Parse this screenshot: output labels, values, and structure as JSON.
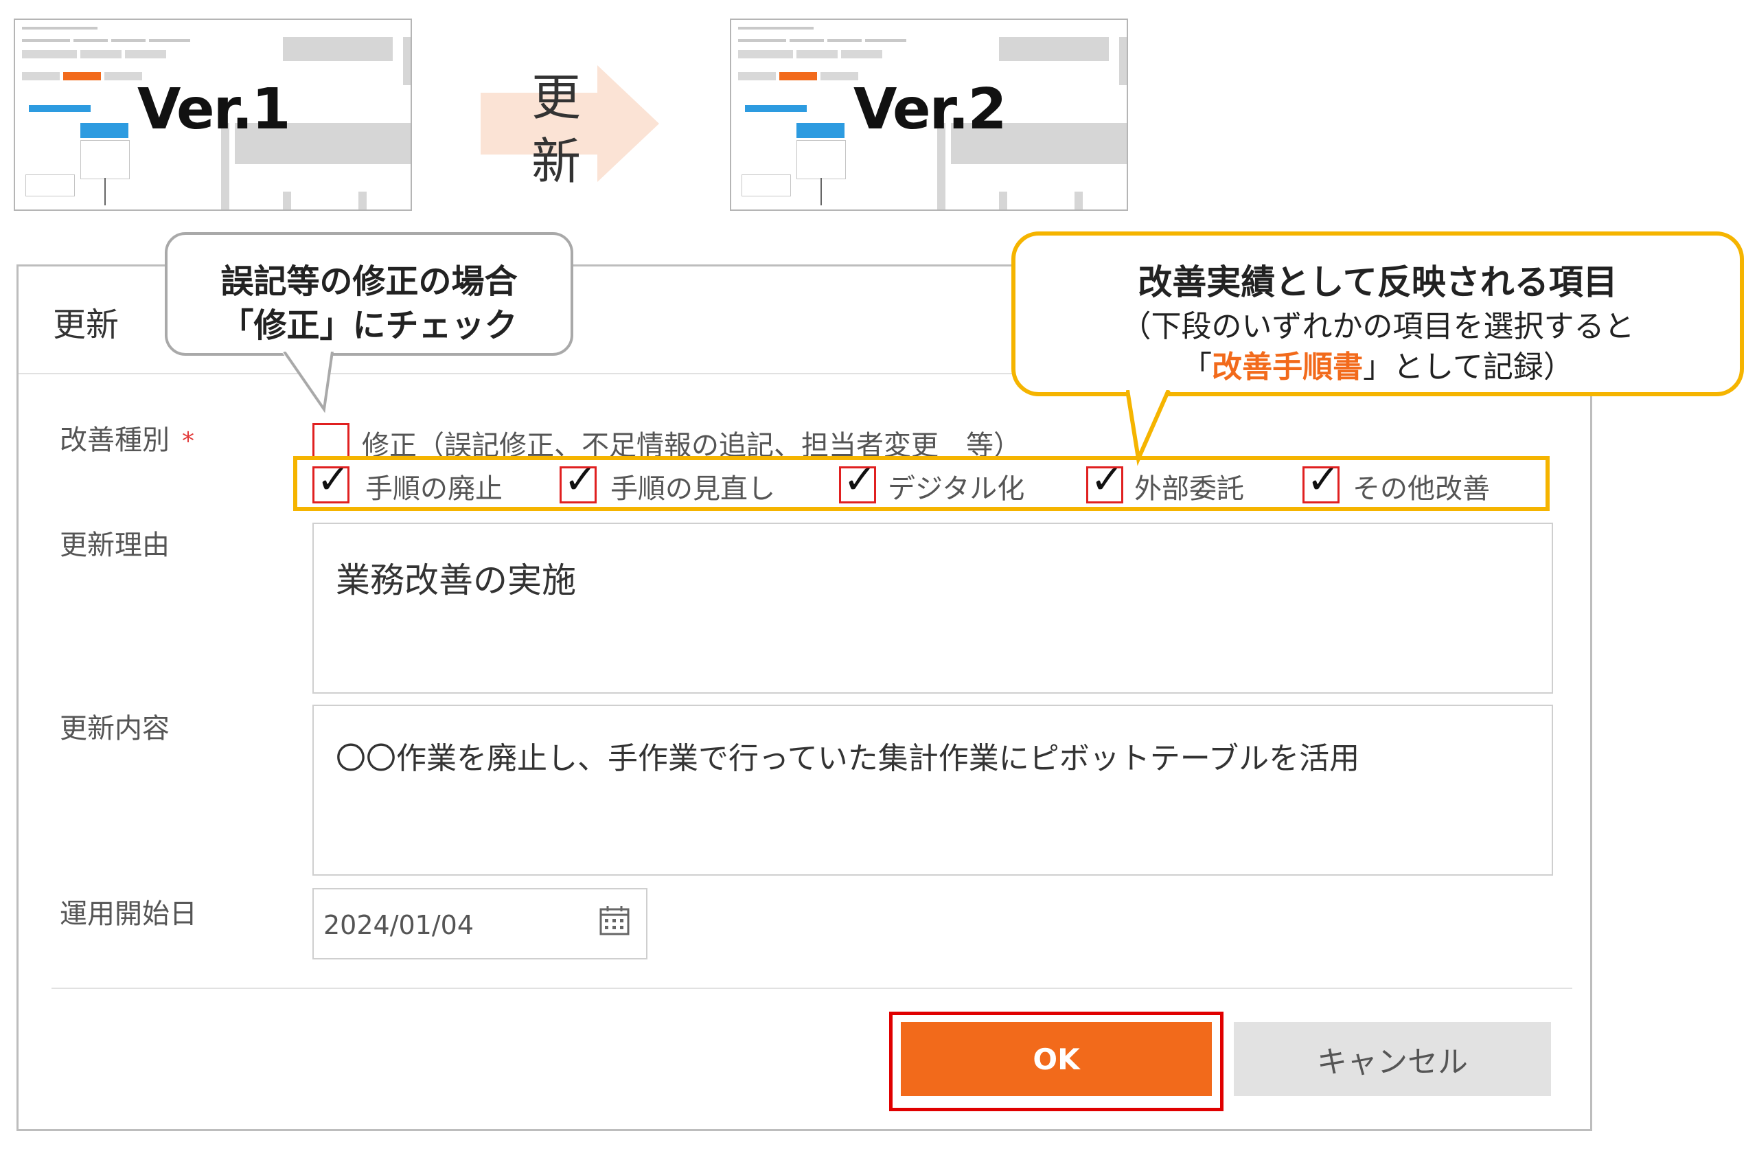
{
  "thumbnails": [
    {
      "version_label": "Ver.1"
    },
    {
      "version_label": "Ver.2"
    }
  ],
  "arrow": {
    "line1": "更",
    "line2": "新"
  },
  "dialog": {
    "title": "更新",
    "improvement_type": {
      "label": "改善種別",
      "required_mark": "*",
      "correction": {
        "label": "修正（誤記修正、不足情報の追記、担当者変更　等）",
        "checked": false
      },
      "options": [
        {
          "label": "手順の廃止",
          "checked": true
        },
        {
          "label": "手順の見直し",
          "checked": true
        },
        {
          "label": "デジタル化",
          "checked": true
        },
        {
          "label": "外部委託",
          "checked": true
        },
        {
          "label": "その他改善",
          "checked": true
        }
      ]
    },
    "update_reason": {
      "label": "更新理由",
      "value": "業務改善の実施"
    },
    "update_content": {
      "label": "更新内容",
      "value": "〇〇作業を廃止し、手作業で行っていた集計作業にピボットテーブルを活用"
    },
    "start_date": {
      "label": "運用開始日",
      "value": "2024/01/04"
    },
    "ok_label": "OK",
    "cancel_label": "キャンセル"
  },
  "callouts": {
    "correction": {
      "line1": "誤記等の修正の場合",
      "line2": "「修正」にチェック"
    },
    "improvement": {
      "title": "改善実績として反映される項目",
      "line2": "（下段のいずれかの項目を選択すると",
      "line3_prefix": "「",
      "line3_highlight": "改善手順書",
      "line3_suffix": "」として記録）",
      "highlight_color": "#f26a1b",
      "border_color": "#f5b400"
    }
  },
  "colors": {
    "accent": "#f26a1b",
    "checkbox_border": "#e02020",
    "highlight_box": "#f5b400"
  }
}
